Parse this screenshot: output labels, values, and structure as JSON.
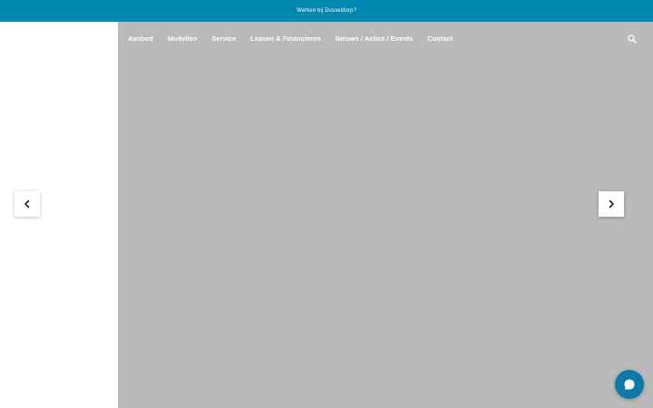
{
  "topbar": {
    "link_label": "Werken bij Dusseldorp?"
  },
  "nav": {
    "items": [
      {
        "label": "Aanbod"
      },
      {
        "label": "Modellen"
      },
      {
        "label": "Service"
      },
      {
        "label": "Leasen & Financieren"
      },
      {
        "label": "Nieuws / Acties / Events"
      },
      {
        "label": "Contact"
      }
    ],
    "search_icon": "search-icon"
  },
  "carousel": {
    "prev_icon": "chevron-left-icon",
    "next_icon": "chevron-right-icon"
  },
  "chat": {
    "icon": "chat-icon"
  },
  "colors": {
    "brand": "#0087b0",
    "hero_bg": "#bababa",
    "chat": "#0a7aa8"
  }
}
